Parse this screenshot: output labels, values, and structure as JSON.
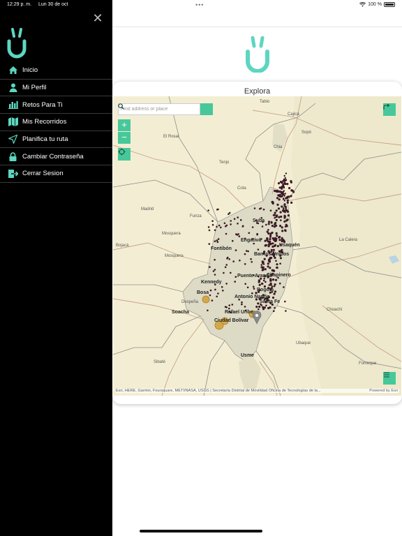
{
  "status_bar": {
    "time": "12:29 p. m.",
    "date": "Lun 30 de oct",
    "battery": "100 %"
  },
  "colors": {
    "accent": "#47c89a",
    "logo": "#5dd6c0",
    "sidebar_bg": "#000000",
    "point": "#3b1a24"
  },
  "sidebar": {
    "close_icon": "close-icon",
    "items": [
      {
        "label": "Inicio",
        "icon": "home-icon"
      },
      {
        "label": "Mi Perfil",
        "icon": "user-icon"
      },
      {
        "label": "Retos Para Ti",
        "icon": "bar-chart-icon"
      },
      {
        "label": "Mis Recorridos",
        "icon": "map-icon"
      },
      {
        "label": "Planifica tu ruta",
        "icon": "navigation-arrow-icon"
      },
      {
        "label": "Cambiar Contraseña",
        "icon": "lock-icon"
      },
      {
        "label": "Cerrar Sesion",
        "icon": "logout-icon"
      }
    ]
  },
  "card": {
    "title": "Explora"
  },
  "map": {
    "search_placeholder": "Find address or place",
    "zoom_in": "+",
    "zoom_out": "−",
    "attribution": "Esri, HERE, Garmin, Foursquare, METI/NASA, USGS | Secretaría Distrital de Movilidad Oficina de Tecnologías de la...",
    "powered_by": "Powered by Esri",
    "place_labels": [
      {
        "name": "Cajicá",
        "bold": false
      },
      {
        "name": "Tabio",
        "bold": false
      },
      {
        "name": "Chia",
        "bold": false
      },
      {
        "name": "El Rosal",
        "bold": false
      },
      {
        "name": "Tenjo",
        "bold": false
      },
      {
        "name": "Sopó",
        "bold": false
      },
      {
        "name": "Cota",
        "bold": false
      },
      {
        "name": "Madrid",
        "bold": false
      },
      {
        "name": "Funza",
        "bold": false
      },
      {
        "name": "Mosquera",
        "bold": false
      },
      {
        "name": "Suba",
        "bold": true
      },
      {
        "name": "Engativá",
        "bold": true
      },
      {
        "name": "Fontibón",
        "bold": true
      },
      {
        "name": "Usaquén",
        "bold": true
      },
      {
        "name": "Barrios Unidos",
        "bold": true
      },
      {
        "name": "Kennedy",
        "bold": true
      },
      {
        "name": "Bosa",
        "bold": true
      },
      {
        "name": "Bogotá",
        "bold": true
      },
      {
        "name": "Santa Fe",
        "bold": true
      },
      {
        "name": "Antonio Nariño",
        "bold": true
      },
      {
        "name": "Rafael Uribe",
        "bold": true
      },
      {
        "name": "Ciudad Bolívar",
        "bold": true
      },
      {
        "name": "Soacha",
        "bold": true
      },
      {
        "name": "Usme",
        "bold": true
      },
      {
        "name": "La Calera",
        "bold": false
      },
      {
        "name": "Choachí",
        "bold": false
      },
      {
        "name": "Ubaque",
        "bold": false
      },
      {
        "name": "Fomeque",
        "bold": false
      },
      {
        "name": "Sibaté",
        "bold": false
      },
      {
        "name": "Bojacá",
        "bold": false
      },
      {
        "name": "Despeña",
        "bold": false
      },
      {
        "name": "Puente Aranda",
        "bold": true
      },
      {
        "name": "Chapinero",
        "bold": true
      },
      {
        "name": "Mosquera",
        "bold": false
      }
    ]
  }
}
